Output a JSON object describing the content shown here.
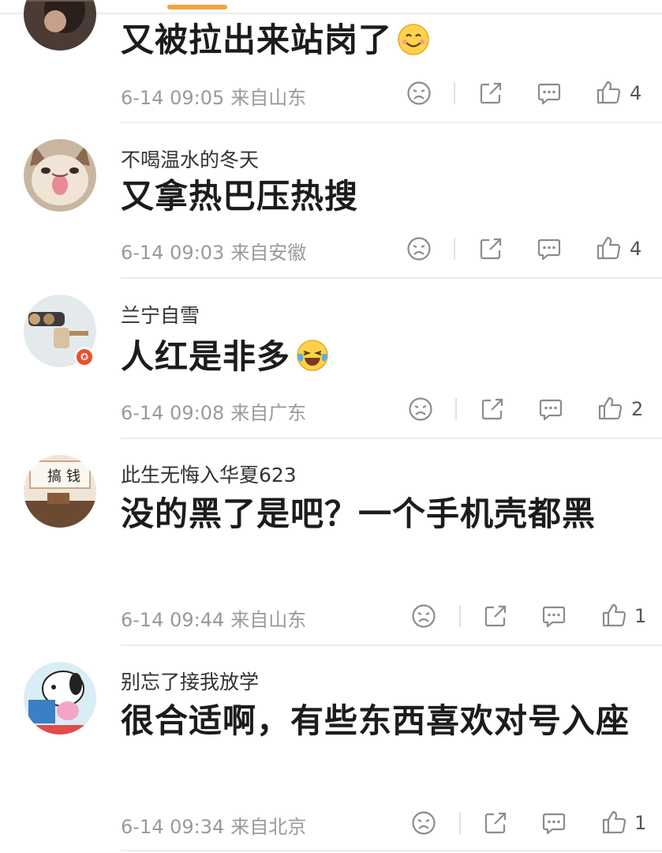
{
  "comments": [
    {
      "username": "",
      "text": "又被拉出来站岗了",
      "emoji": "smiling-face-emoji",
      "time": "6-14 09:05",
      "location": "来自山东",
      "likes": "4"
    },
    {
      "username": "不喝温水的冬天",
      "text": "又拿热巴压热搜",
      "time": "6-14 09:03",
      "location": "来自安徽",
      "likes": "4"
    },
    {
      "username": "兰宁自雪",
      "text": "人红是非多",
      "emoji": "laughing-crying-face-emoji",
      "time": "6-14 09:08",
      "location": "来自广东",
      "likes": "2"
    },
    {
      "username": "此生无悔入华夏623",
      "text": "没的黑了是吧？一个手机壳都黑",
      "time": "6-14 09:44",
      "location": "来自山东",
      "likes": "1"
    },
    {
      "username": "别忘了接我放学",
      "text": "很合适啊，有些东西喜欢对号入座",
      "time": "6-14 09:34",
      "location": "来自北京",
      "likes": "1"
    }
  ],
  "avatar_seals": [
    "搞",
    "钱"
  ],
  "colors": {
    "accent": "#f3a23a",
    "meta_text": "#9a9a9a",
    "icon_gray": "#8c8c8c",
    "divider": "#ececec",
    "badge": "#e8502f"
  }
}
